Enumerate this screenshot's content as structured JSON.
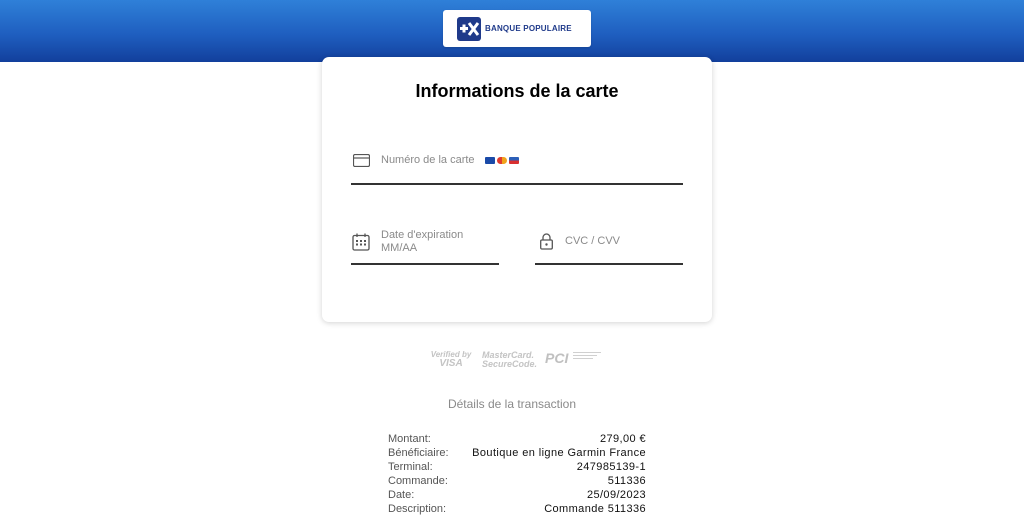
{
  "header": {
    "bank_name": "BANQUE POPULAIRE",
    "logo_icon": "banque-populaire-logo-icon"
  },
  "card_form": {
    "title": "Informations de la carte",
    "card_number_placeholder": "Numéro de la carte",
    "card_icon": "credit-card-icon",
    "brand_icons": [
      "visa-icon",
      "mastercard-icon",
      "card-network-icon"
    ],
    "expiry_label": "Date d'expiration",
    "expiry_placeholder": "MM/AA",
    "calendar_icon": "calendar-icon",
    "cvc_placeholder": "CVC / CVV",
    "lock_icon": "lock-icon"
  },
  "trust_badges": {
    "verified_visa_line1": "Verified by",
    "verified_visa_line2": "VISA",
    "mastercard_line1": "MasterCard.",
    "mastercard_line2": "SecureCode.",
    "pci": "PCI"
  },
  "transaction": {
    "title": "Détails de la transaction",
    "rows": [
      {
        "label": "Montant:",
        "value": "279,00 €"
      },
      {
        "label": "Bénéficiaire:",
        "value": "Boutique en ligne Garmin France"
      },
      {
        "label": "Terminal:",
        "value": "247985139-1"
      },
      {
        "label": "Commande:",
        "value": "511336"
      },
      {
        "label": "Date:",
        "value": "25/09/2023"
      },
      {
        "label": "Description:",
        "value": "Commande 511336"
      }
    ]
  },
  "colors": {
    "header_top": "#2f80d8",
    "header_bottom": "#123f9c",
    "brand_blue": "#1f3a8a"
  }
}
